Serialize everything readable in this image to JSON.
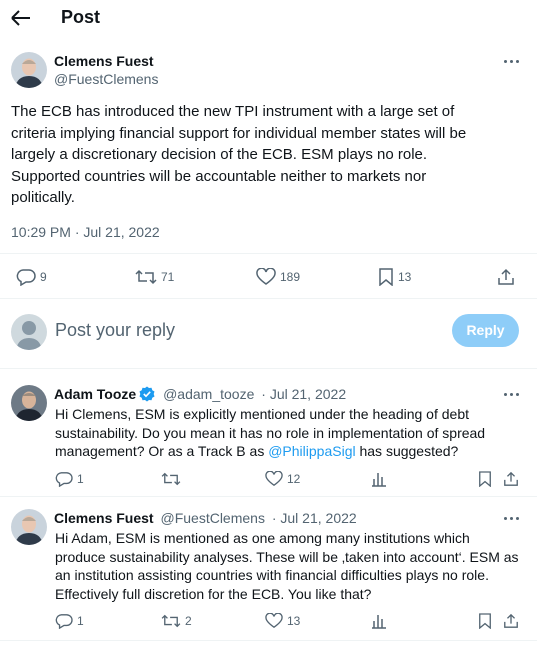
{
  "header": {
    "title": "Post"
  },
  "tweet": {
    "author_name": "Clemens Fuest",
    "author_handle": "@FuestClemens",
    "text": "The ECB has introduced the new TPI instrument with a large set of\ncriteria implying financial support for individual member states will be\nlargely a discretionary decision of the ECB. ESM  plays no role.\nSupported countries will be accountable neither to markets nor\npolitically.",
    "timestamp": "10:29 PM · Jul 21, 2022",
    "stats": {
      "replies": "9",
      "reposts": "71",
      "likes": "189",
      "bookmarks": "13"
    }
  },
  "composer": {
    "placeholder": "Post your reply",
    "button_label": "Reply"
  },
  "replies": [
    {
      "author_name": "Adam Tooze",
      "author_handle": "@adam_tooze",
      "date": "· Jul 21, 2022",
      "verified": true,
      "text_before": "Hi Clemens, ESM is explicitly mentioned under the heading of debt\nsustainability. Do you mean it has no role in implementation of spread\nmanagement? Or as a Track B as ",
      "mention": "@PhilippaSigl",
      "text_after": " has suggested?",
      "stats": {
        "replies": "1",
        "reposts": "",
        "likes": "12"
      }
    },
    {
      "author_name": "Clemens Fuest",
      "author_handle": "@FuestClemens",
      "date": "· Jul 21, 2022",
      "text": "Hi Adam, ESM is mentioned as one among many institutions which\nproduce sustainability analyses. These will be ‚taken into account‘. ESM as\nan institution assisting countries with financial difficulties plays no role.\nEffectively full discretion for the ECB. You like that?",
      "stats": {
        "replies": "1",
        "reposts": "2",
        "likes": "13"
      }
    }
  ],
  "colors": {
    "accent": "#1d9bf0",
    "reply_button": "#8ecdf8",
    "muted": "#536471"
  }
}
